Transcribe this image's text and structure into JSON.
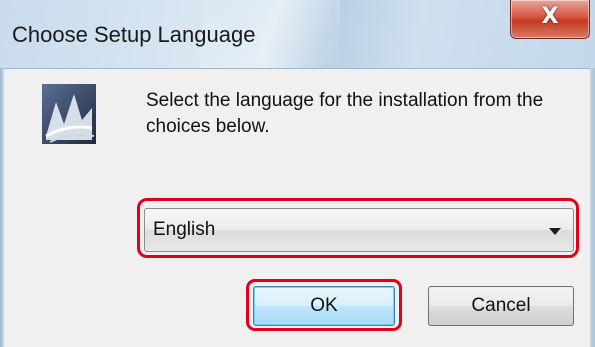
{
  "window": {
    "title": "Choose Setup Language",
    "close_glyph": "X"
  },
  "dialog": {
    "icon": "installer-icon",
    "message": "Select the language for the installation from the choices below."
  },
  "language_select": {
    "selected": "English"
  },
  "buttons": {
    "ok_label": "OK",
    "cancel_label": "Cancel"
  },
  "colors": {
    "highlight": "#e0001a",
    "close_button": "#c23a22"
  }
}
